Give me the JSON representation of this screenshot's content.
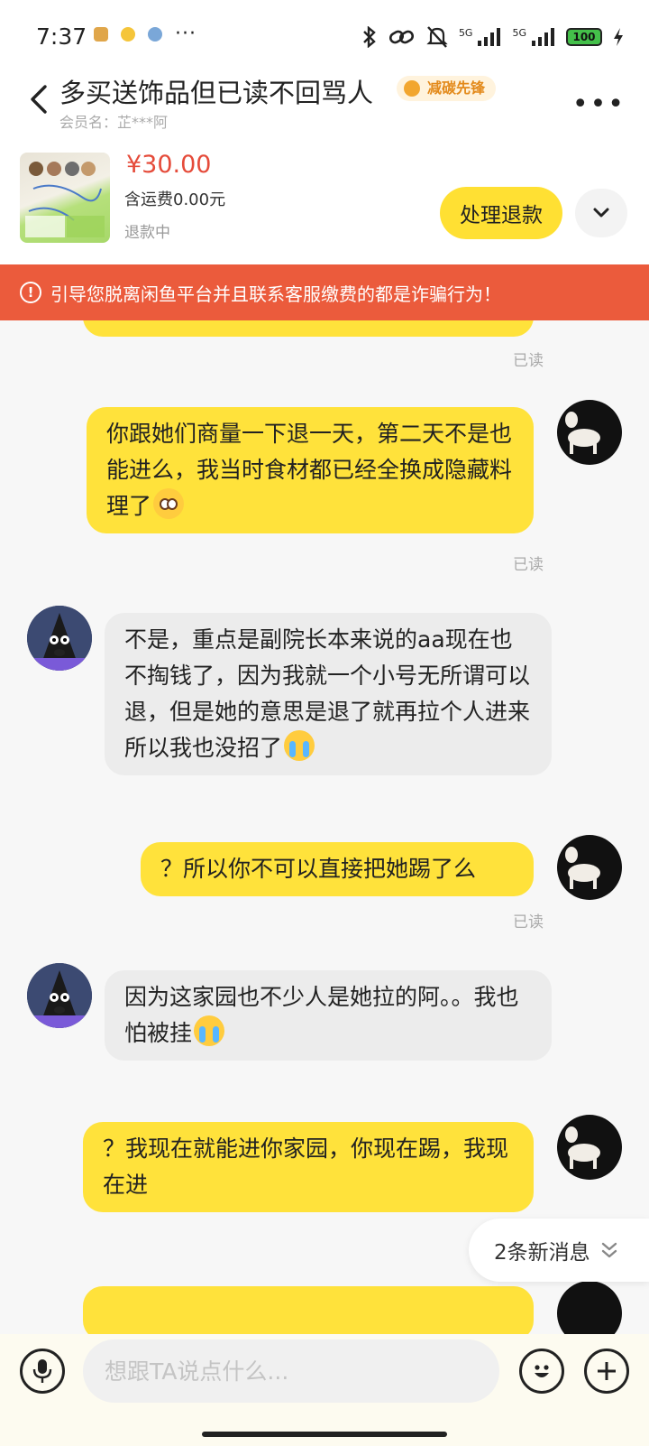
{
  "status_bar": {
    "time": "7:37",
    "more": "···",
    "network_1": "5G",
    "network_2": "5G",
    "battery": "100"
  },
  "header": {
    "title": "多买送饰品但已读不回骂人",
    "badge": "减碳先锋",
    "member": "会员名：芷***阿",
    "more": "•••"
  },
  "product": {
    "price": "¥30.00",
    "shipping": "含运费0.00元",
    "status": "退款中",
    "action_label": "处理退款"
  },
  "warning": {
    "text": "引导您脱离闲鱼平台并且联系客服缴费的都是诈骗行为！"
  },
  "messages": [
    {
      "from": "me",
      "text": "你跟她们商量一下退一天，第二天不是也能进么，我当时食材都已经全换成隐藏料理了",
      "emoji": "flushed-face",
      "read": "已读"
    },
    {
      "from": "them",
      "text": "不是，重点是副院长本来说的aa现在也不掏钱了，因为我就一个小号无所谓可以退，但是她的意思是退了就再拉个人进来所以我也没招了",
      "emoji": "crying-face"
    },
    {
      "from": "me",
      "text": "？所以你不可以直接把她踢了么",
      "read": "已读"
    },
    {
      "from": "them",
      "text": "因为这家园也不少人是她拉的阿。。我也怕被挂",
      "emoji": "crying-face"
    },
    {
      "from": "me",
      "text": "？我现在就能进你家园，你现在踢，我现在进"
    }
  ],
  "top_read": "已读",
  "new_messages": "2条新消息",
  "input": {
    "placeholder": "想跟TA说点什么..."
  },
  "colors": {
    "accent": "#ffe23b",
    "warning": "#eb5b3c",
    "price": "#e54b3a"
  }
}
